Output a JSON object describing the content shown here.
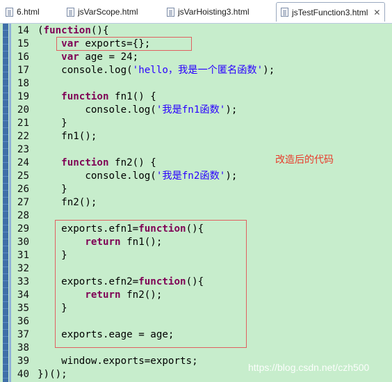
{
  "tabs": [
    {
      "label": "6.html"
    },
    {
      "label": "jsVarScope.html"
    },
    {
      "label": "jsVarHoisting3.html"
    },
    {
      "label": "jsTestFunction3.html",
      "active": true
    }
  ],
  "tab_close_glyph": "✕",
  "lines": [
    {
      "num": "14",
      "segs": [
        [
          "p",
          "("
        ],
        [
          "k",
          "function"
        ],
        [
          "p",
          "(){"
        ]
      ]
    },
    {
      "num": "15",
      "segs": [
        [
          "p",
          "    "
        ],
        [
          "k",
          "var"
        ],
        [
          "p",
          " exports={};"
        ]
      ]
    },
    {
      "num": "16",
      "segs": [
        [
          "p",
          "    "
        ],
        [
          "k",
          "var"
        ],
        [
          "p",
          " age = 24;"
        ]
      ]
    },
    {
      "num": "17",
      "segs": [
        [
          "p",
          "    console.log("
        ],
        [
          "s",
          "'hello，我是一个匿名函数'"
        ],
        [
          "p",
          ");"
        ]
      ]
    },
    {
      "num": "18",
      "segs": []
    },
    {
      "num": "19",
      "segs": [
        [
          "p",
          "    "
        ],
        [
          "k",
          "function"
        ],
        [
          "p",
          " fn1() {"
        ]
      ]
    },
    {
      "num": "20",
      "segs": [
        [
          "p",
          "        console.log("
        ],
        [
          "s",
          "'我是fn1函数'"
        ],
        [
          "p",
          ");"
        ]
      ]
    },
    {
      "num": "21",
      "segs": [
        [
          "p",
          "    }"
        ]
      ]
    },
    {
      "num": "22",
      "segs": [
        [
          "p",
          "    fn1();"
        ]
      ]
    },
    {
      "num": "23",
      "segs": []
    },
    {
      "num": "24",
      "segs": [
        [
          "p",
          "    "
        ],
        [
          "k",
          "function"
        ],
        [
          "p",
          " fn2() {"
        ]
      ]
    },
    {
      "num": "25",
      "segs": [
        [
          "p",
          "        console.log("
        ],
        [
          "s",
          "'我是fn2函数'"
        ],
        [
          "p",
          ");"
        ]
      ]
    },
    {
      "num": "26",
      "segs": [
        [
          "p",
          "    }"
        ]
      ]
    },
    {
      "num": "27",
      "segs": [
        [
          "p",
          "    fn2();"
        ]
      ]
    },
    {
      "num": "28",
      "segs": []
    },
    {
      "num": "29",
      "segs": [
        [
          "p",
          "    exports.efn1="
        ],
        [
          "k",
          "function"
        ],
        [
          "p",
          "(){"
        ]
      ]
    },
    {
      "num": "30",
      "segs": [
        [
          "p",
          "        "
        ],
        [
          "k",
          "return"
        ],
        [
          "p",
          " fn1();"
        ]
      ]
    },
    {
      "num": "31",
      "segs": [
        [
          "p",
          "    }"
        ]
      ]
    },
    {
      "num": "32",
      "segs": []
    },
    {
      "num": "33",
      "segs": [
        [
          "p",
          "    exports.efn2="
        ],
        [
          "k",
          "function"
        ],
        [
          "p",
          "(){"
        ]
      ]
    },
    {
      "num": "34",
      "segs": [
        [
          "p",
          "        "
        ],
        [
          "k",
          "return"
        ],
        [
          "p",
          " fn2();"
        ]
      ]
    },
    {
      "num": "35",
      "segs": [
        [
          "p",
          "    }"
        ]
      ]
    },
    {
      "num": "36",
      "segs": []
    },
    {
      "num": "37",
      "segs": [
        [
          "p",
          "    exports.eage = age;"
        ]
      ]
    },
    {
      "num": "38",
      "segs": []
    },
    {
      "num": "39",
      "segs": [
        [
          "p",
          "    window.exports=exports;"
        ]
      ]
    },
    {
      "num": "40",
      "segs": [
        [
          "p",
          "})();"
        ]
      ]
    }
  ],
  "annotation": "改造后的代码",
  "watermark": "https://blog.csdn.net/czh500",
  "colors": {
    "editor_bg": "#c7edcc",
    "keyword": "#7f0055",
    "string": "#2a00ff",
    "highlight_box": "#e06060",
    "annotation": "#e83a2a"
  }
}
